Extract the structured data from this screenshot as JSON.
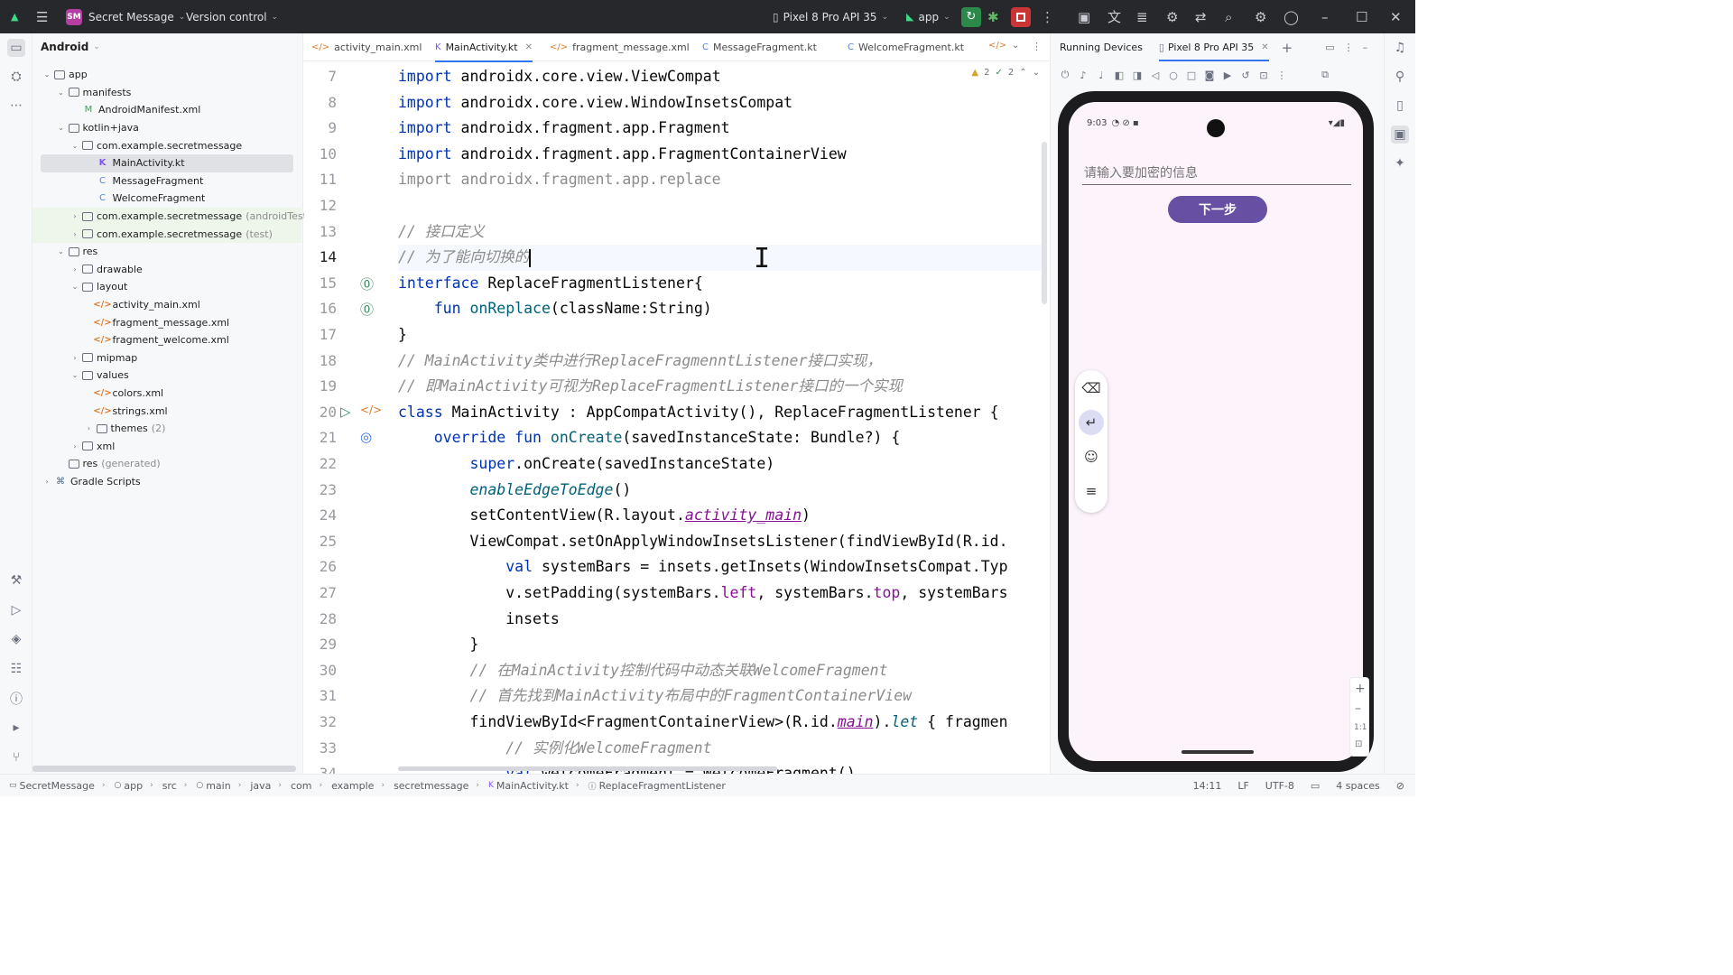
{
  "titlebar": {
    "project_badge": "SM",
    "project_name": "Secret Message",
    "vcs": "Version control",
    "device": "Pixel 8 Pro API 35",
    "run_config": "app"
  },
  "project_panel": {
    "view": "Android",
    "tree": [
      {
        "label": "app",
        "suffix": "",
        "depth": 0,
        "arrow": "open",
        "icon": "folder"
      },
      {
        "label": "manifests",
        "suffix": "",
        "depth": 1,
        "arrow": "open",
        "icon": "folder"
      },
      {
        "label": "AndroidManifest.xml",
        "suffix": "",
        "depth": 2,
        "arrow": "",
        "icon": "manifest"
      },
      {
        "label": "kotlin+java",
        "suffix": "",
        "depth": 1,
        "arrow": "open",
        "icon": "folder"
      },
      {
        "label": "com.example.secretmessage",
        "suffix": "",
        "depth": 2,
        "arrow": "open",
        "icon": "folder"
      },
      {
        "label": "MainActivity.kt",
        "suffix": "",
        "depth": 3,
        "arrow": "",
        "icon": "kt",
        "selected": true
      },
      {
        "label": "MessageFragment",
        "suffix": "",
        "depth": 3,
        "arrow": "",
        "icon": "class"
      },
      {
        "label": "WelcomeFragment",
        "suffix": "",
        "depth": 3,
        "arrow": "",
        "icon": "class"
      },
      {
        "label": "com.example.secretmessage",
        "suffix": "(androidTest)",
        "depth": 2,
        "arrow": "closed",
        "icon": "folder",
        "green": true
      },
      {
        "label": "com.example.secretmessage",
        "suffix": "(test)",
        "depth": 2,
        "arrow": "closed",
        "icon": "folder",
        "green": true
      },
      {
        "label": "res",
        "suffix": "",
        "depth": 1,
        "arrow": "open",
        "icon": "folder"
      },
      {
        "label": "drawable",
        "suffix": "",
        "depth": 2,
        "arrow": "closed",
        "icon": "folder"
      },
      {
        "label": "layout",
        "suffix": "",
        "depth": 2,
        "arrow": "open",
        "icon": "folder"
      },
      {
        "label": "activity_main.xml",
        "suffix": "",
        "depth": 3,
        "arrow": "",
        "icon": "xml"
      },
      {
        "label": "fragment_message.xml",
        "suffix": "",
        "depth": 3,
        "arrow": "",
        "icon": "xml"
      },
      {
        "label": "fragment_welcome.xml",
        "suffix": "",
        "depth": 3,
        "arrow": "",
        "icon": "xml"
      },
      {
        "label": "mipmap",
        "suffix": "",
        "depth": 2,
        "arrow": "closed",
        "icon": "folder"
      },
      {
        "label": "values",
        "suffix": "",
        "depth": 2,
        "arrow": "open",
        "icon": "folder"
      },
      {
        "label": "colors.xml",
        "suffix": "",
        "depth": 3,
        "arrow": "",
        "icon": "xml"
      },
      {
        "label": "strings.xml",
        "suffix": "",
        "depth": 3,
        "arrow": "",
        "icon": "xml"
      },
      {
        "label": "themes",
        "suffix": "(2)",
        "depth": 3,
        "arrow": "closed",
        "icon": "folder"
      },
      {
        "label": "xml",
        "suffix": "",
        "depth": 2,
        "arrow": "closed",
        "icon": "folder"
      },
      {
        "label": "res",
        "suffix": "(generated)",
        "depth": 1,
        "arrow": "",
        "icon": "folder"
      },
      {
        "label": "Gradle Scripts",
        "suffix": "",
        "depth": 0,
        "arrow": "closed",
        "icon": "gradle"
      }
    ]
  },
  "editor": {
    "tabs": [
      {
        "label": "activity_main.xml",
        "icon": "xml"
      },
      {
        "label": "MainActivity.kt",
        "icon": "kt",
        "active": true
      },
      {
        "label": "fragment_message.xml",
        "icon": "xml"
      },
      {
        "label": "MessageFragment.kt",
        "icon": "class"
      },
      {
        "label": "WelcomeFragment.kt",
        "icon": "class"
      }
    ],
    "inspections": {
      "warnings": "2",
      "checks": "2"
    },
    "current_line": 14,
    "lines": [
      {
        "n": 7,
        "html": "<span class=\"kw\">import</span> androidx.core.view.ViewCompat"
      },
      {
        "n": 8,
        "html": "<span class=\"kw\">import</span> androidx.core.view.WindowInsetsCompat"
      },
      {
        "n": 9,
        "html": "<span class=\"kw\">import</span> androidx.fragment.app.Fragment"
      },
      {
        "n": 10,
        "html": "<span class=\"kw\">import</span> androidx.fragment.app.FragmentContainerView"
      },
      {
        "n": 11,
        "html": "<span class=\"gray\">import androidx.fragment.app.replace</span>"
      },
      {
        "n": 12,
        "html": ""
      },
      {
        "n": 13,
        "html": "<span class=\"cm\">// 接口定义</span>"
      },
      {
        "n": 14,
        "html": "<span class=\"cm\">// 为了能向切换的</span><span class=\"caret\"></span>"
      },
      {
        "n": 15,
        "html": "<span class=\"kw\">interface</span> ReplaceFragmentListener{"
      },
      {
        "n": 16,
        "html": "    <span class=\"kw\">fun</span> <span class=\"fn\">onReplace</span>(className:String)"
      },
      {
        "n": 17,
        "html": "}"
      },
      {
        "n": 18,
        "html": "<span class=\"cm\">// MainActivity类中进行ReplaceFragmenntListener接口实现，</span>"
      },
      {
        "n": 19,
        "html": "<span class=\"cm\">// 即MainActivity可视为ReplaceFragmentListener接口的一个实现</span>"
      },
      {
        "n": 20,
        "html": "<span class=\"kw\">class</span> MainActivity : AppCompatActivity(), ReplaceFragmentListener {"
      },
      {
        "n": 21,
        "html": "    <span class=\"kw\">override fun</span> <span class=\"fn\">onCreate</span>(savedInstanceState: Bundle?) {"
      },
      {
        "n": 22,
        "html": "        <span class=\"kw\">super</span>.onCreate(savedInstanceState)"
      },
      {
        "n": 23,
        "html": "        <span class=\"it\">enableEdgeToEdge</span>()"
      },
      {
        "n": 24,
        "html": "        setContentView(R.layout.<span class=\"pu\">activity_main</span>)"
      },
      {
        "n": 25,
        "html": "        ViewCompat.setOnApplyWindowInsetsListener(findViewById(R.id."
      },
      {
        "n": 26,
        "html": "            <span class=\"kw\">val</span> systemBars = insets.getInsets(WindowInsetsCompat.Typ"
      },
      {
        "n": 27,
        "html": "            v.setPadding(systemBars.<span class=\"purp\">left</span>, systemBars.<span class=\"purp\">top</span>, systemBars"
      },
      {
        "n": 28,
        "html": "            insets"
      },
      {
        "n": 29,
        "html": "        }"
      },
      {
        "n": 30,
        "html": "        <span class=\"cm\">// 在MainActivity控制代码中动态关联WelcomeFragment</span>"
      },
      {
        "n": 31,
        "html": "        <span class=\"cm\">// 首先找到MainActivity布局中的FragmentContainerView</span>"
      },
      {
        "n": 32,
        "html": "        findViewById&lt;FragmentContainerView&gt;(R.id.<span class=\"pu\">main</span>).<span class=\"it\">let</span> { fragmen"
      },
      {
        "n": 33,
        "html": "            <span class=\"cm\">// 实例化WelcomeFragment</span>"
      },
      {
        "n": 34,
        "html": "            <span class=\"kw\">val</span> welcomeFragment = WelcomeFragment()"
      }
    ]
  },
  "devices": {
    "panel_title": "Running Devices",
    "device_tab": "Pixel 8 Pro API 35",
    "phone": {
      "time": "9:03",
      "input_placeholder": "请输入要加密的信息",
      "next_button": "下一步"
    }
  },
  "statusbar": {
    "breadcrumbs": [
      "SecretMessage",
      "app",
      "src",
      "main",
      "java",
      "com",
      "example",
      "secretmessage",
      "MainActivity.kt",
      "ReplaceFragmentListener"
    ],
    "position": "14:11",
    "line_sep": "LF",
    "encoding": "UTF-8",
    "indent": "4 spaces"
  }
}
